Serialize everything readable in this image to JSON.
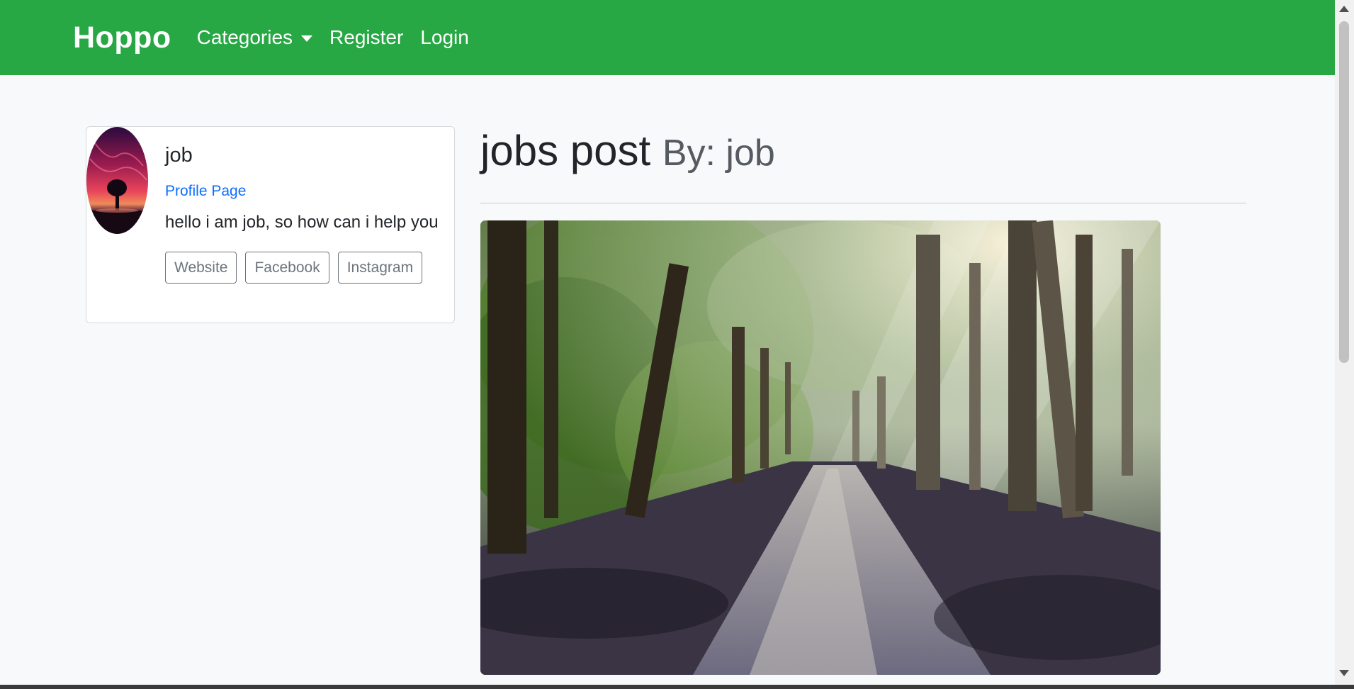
{
  "navbar": {
    "brand": "Hoppo",
    "items": [
      {
        "label": "Categories",
        "dropdown": true
      },
      {
        "label": "Register"
      },
      {
        "label": "Login"
      }
    ],
    "background": "#28a745"
  },
  "profile": {
    "name": "job",
    "profile_link": "Profile Page",
    "bio": "hello i am job, so how can i help you",
    "buttons": [
      "Website",
      "Facebook",
      "Instagram"
    ]
  },
  "post": {
    "title": "jobs post",
    "byline": "By: job"
  },
  "colors": {
    "link": "#0d6efd",
    "muted_button": "#6c757d"
  }
}
